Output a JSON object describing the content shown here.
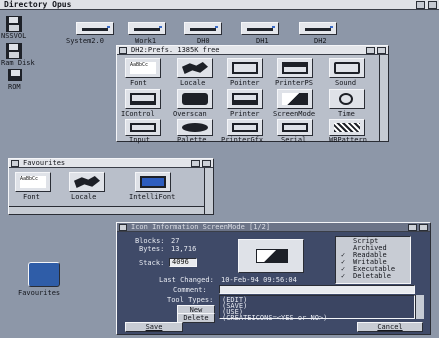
{
  "screen": {
    "title": "Directory Opus"
  },
  "desktop": {
    "left_icons": [
      {
        "label": "NSSVOL"
      },
      {
        "label": "Ram Disk"
      },
      {
        "label": "ROM"
      }
    ],
    "drives": [
      {
        "label": "System2.0"
      },
      {
        "label": "Work1"
      },
      {
        "label": "DH0"
      },
      {
        "label": "DH1"
      },
      {
        "label": "DH2"
      }
    ],
    "favourites_drawer": {
      "label": "Favourites"
    }
  },
  "prefs_window": {
    "title": "DH2:Prefs.  1385K free",
    "icons": [
      "Font",
      "Locale",
      "Pointer",
      "PrinterPS",
      "Sound",
      "IControl",
      "Overscan",
      "Printer",
      "ScreenMode",
      "Time",
      "Input",
      "Palette",
      "PrinterGfx",
      "Serial",
      "WBPattern"
    ]
  },
  "favourites_window": {
    "title": "Favourites",
    "icons": [
      "Font",
      "Locale",
      "IntelliFont"
    ]
  },
  "info_window": {
    "title": "Icon Information  ScreenMode [1/2]",
    "blocks_label": "Blocks:",
    "blocks_value": "27",
    "bytes_label": "Bytes:",
    "bytes_value": "13,716",
    "stack_label": "Stack:",
    "stack_value": "4096",
    "last_changed_label": "Last Changed:",
    "last_changed_value": "10-Feb-94 09:56:04",
    "comment_label": "Comment:",
    "comment_value": "",
    "tool_types_label": "Tool Types:",
    "tool_types": [
      "(EDIT)",
      "(SAVE)",
      "(USE)",
      "(CREATEICONS=<YES or NO>)"
    ],
    "new_button": "New",
    "delete_button": "Delete",
    "save_button": "Save",
    "cancel_button": "Cancel",
    "flags": [
      "Script",
      "Archived",
      "Readable",
      "Writable",
      "Executable",
      "Deletable"
    ],
    "flags_checked": [
      false,
      false,
      true,
      true,
      true,
      true
    ]
  }
}
